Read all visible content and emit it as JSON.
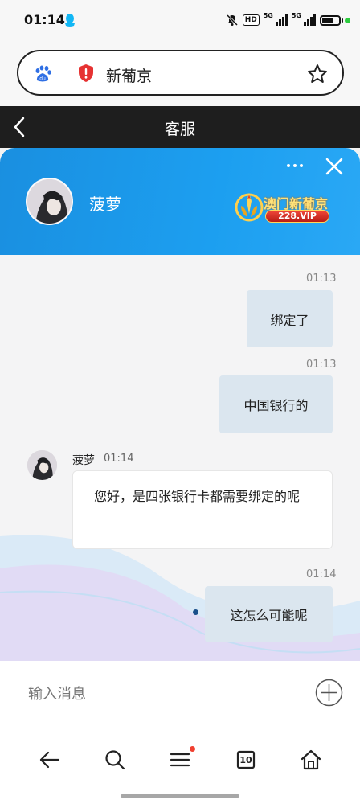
{
  "status_bar": {
    "time": "01:14",
    "net1": "5G",
    "net2": "5G",
    "hd": "HD"
  },
  "browser": {
    "address_text": "新葡京"
  },
  "page": {
    "title": "客服"
  },
  "chat": {
    "agent_name": "菠萝",
    "brand_title": "澳门新葡京",
    "brand_badge": "228.VIP",
    "messages": [
      {
        "direction": "out",
        "time": "01:13",
        "text": "绑定了"
      },
      {
        "direction": "out",
        "time": "01:13",
        "text": "中国银行的"
      },
      {
        "direction": "in",
        "sender": "菠萝",
        "time": "01:14",
        "text": "您好，是四张银行卡都需要绑定的呢"
      },
      {
        "direction": "out",
        "time": "01:14",
        "text": "这怎么可能呢"
      }
    ]
  },
  "input": {
    "placeholder": "输入消息"
  },
  "nav": {
    "tab_count": "10"
  },
  "colors": {
    "header_blue": "#1c9ff0",
    "outgoing_bubble": "#dbe6ef",
    "page_header": "#1e1e1e"
  }
}
